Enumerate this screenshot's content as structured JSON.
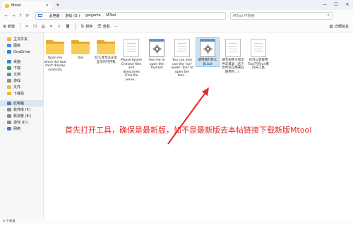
{
  "window": {
    "tab_title": "Mtool",
    "new_tab": "+",
    "minimize": "—",
    "maximize": "☐",
    "close": "✕"
  },
  "address": {
    "path": [
      "此电脑",
      "游戏 (D:)",
      "galgame",
      "MTool"
    ],
    "search_placeholder": "MTool 中搜索"
  },
  "toolbar": {
    "new_label": "新建",
    "sort_label": "排序",
    "view_label": "查看",
    "more": "···",
    "details_label": "详细信息"
  },
  "sidebar": {
    "items": [
      {
        "label": "主文件夹",
        "color": "#f4b63f"
      },
      {
        "label": "图库",
        "color": "#4b8de0"
      },
      {
        "label": "OneDrive",
        "color": "#2d7fd6"
      },
      {
        "label": "桌面",
        "color": "#3a86d6"
      },
      {
        "label": "下载",
        "color": "#2f9e58"
      },
      {
        "label": "文档",
        "color": "#6d8ba8"
      },
      {
        "label": "游戏",
        "color": "#8b8b8b"
      },
      {
        "label": "文件",
        "color": "#f4b63f"
      },
      {
        "label": "下载后",
        "color": "#f4b63f"
      },
      {
        "label": "此电脑",
        "color": "#4a7cc0"
      },
      {
        "label": "软件库 (F:)",
        "color": "#8b8b8b"
      },
      {
        "label": "新加卷 (E:)",
        "color": "#8b8b8b"
      },
      {
        "label": "游戏 (D:)",
        "color": "#8b8b8b"
      },
      {
        "label": "网络",
        "color": "#4a7cc0"
      }
    ]
  },
  "files": [
    {
      "name": "Open me when the tool can't display correctly",
      "kind": "folder"
    },
    {
      "name": "Tool",
      "kind": "folder"
    },
    {
      "name": "在工具无法正常显示时打开我",
      "kind": "folder"
    },
    {
      "name": "Please Ignore Chinese files and directories (This file serve...",
      "kind": "doc"
    },
    {
      "name": "Use me to open the Tool.bat",
      "kind": "bat"
    },
    {
      "name": "You can also use the 'run' under 'Tool' to open the tool...",
      "kind": "doc"
    },
    {
      "name": "使用我打开工具.bat",
      "kind": "bat"
    },
    {
      "name": "请无视英文和文件与目录（这个文件仅仅用来在使用时…）",
      "kind": "doc"
    },
    {
      "name": "也可以直接用Tool下的run来打开工具",
      "kind": "doc"
    }
  ],
  "annotation": "首先打开工具，确保是最新版，如不是最新版去本帖链接下载新版Mtool",
  "status": "9 个项目",
  "colors": {
    "annotation": "#e02b2b",
    "selection": "#cce4f7",
    "folder": "#f9cd5a"
  }
}
